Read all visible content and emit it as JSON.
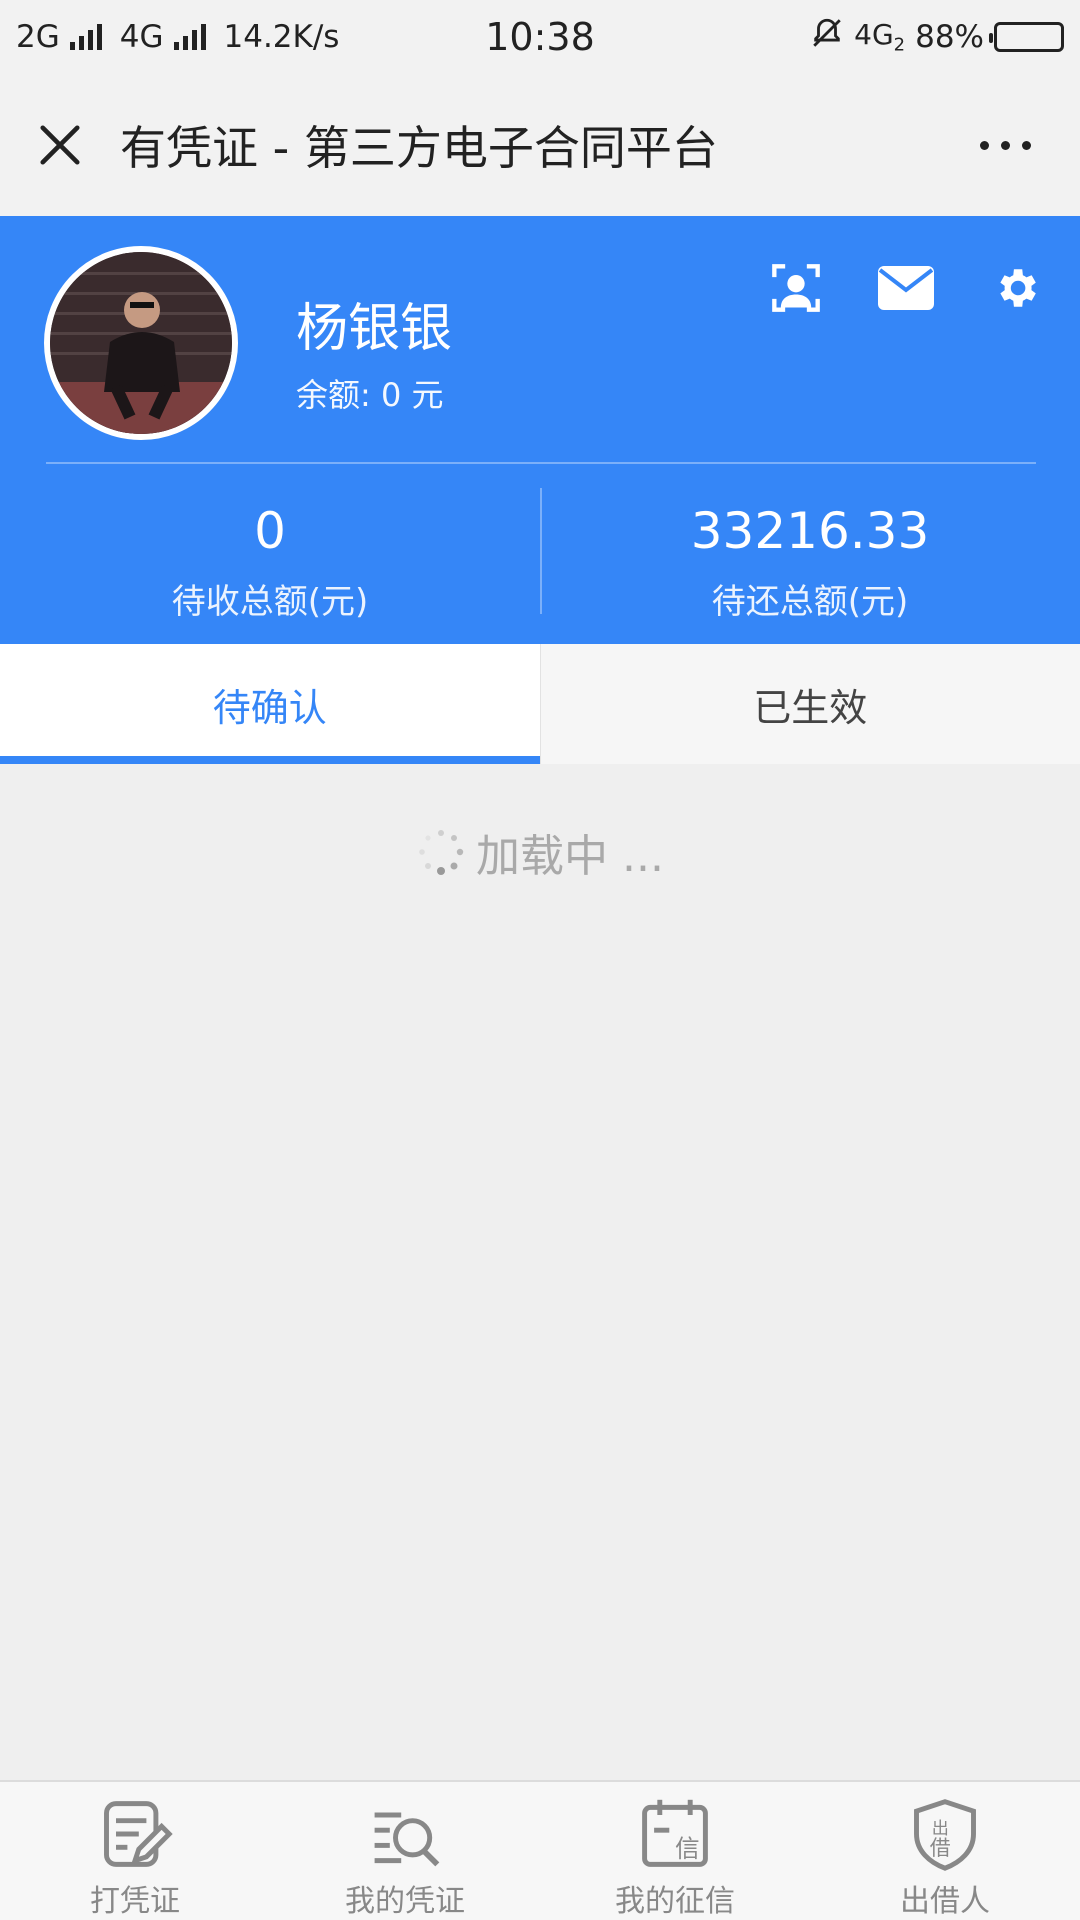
{
  "status_bar": {
    "left_network": "2G",
    "left_network2": "4G",
    "speed": "14.2K/s",
    "time": "10:38",
    "right_network": "4G",
    "right_network_sub": "2",
    "battery_pct": "88%"
  },
  "title_bar": {
    "title": "有凭证 - 第三方电子合同平台"
  },
  "profile": {
    "name": "杨银银",
    "balance": "余额: 0 元",
    "stats": [
      {
        "value": "0",
        "label": "待收总额(元)"
      },
      {
        "value": "33216.33",
        "label": "待还总额(元)"
      }
    ]
  },
  "tabs": [
    {
      "label": "待确认",
      "active": true
    },
    {
      "label": "已生效",
      "active": false
    }
  ],
  "loading_text": "加载中 ...",
  "bottom_nav": [
    {
      "label": "打凭证",
      "icon": "edit-document-icon"
    },
    {
      "label": "我的凭证",
      "icon": "search-list-icon"
    },
    {
      "label": "我的征信",
      "icon": "credit-calendar-icon"
    },
    {
      "label": "出借人",
      "icon": "lender-shield-icon"
    }
  ],
  "colors": {
    "brand_blue": "#3586f7",
    "progress_green": "#2f9a77",
    "loading_gray": "#a9a9a9"
  }
}
